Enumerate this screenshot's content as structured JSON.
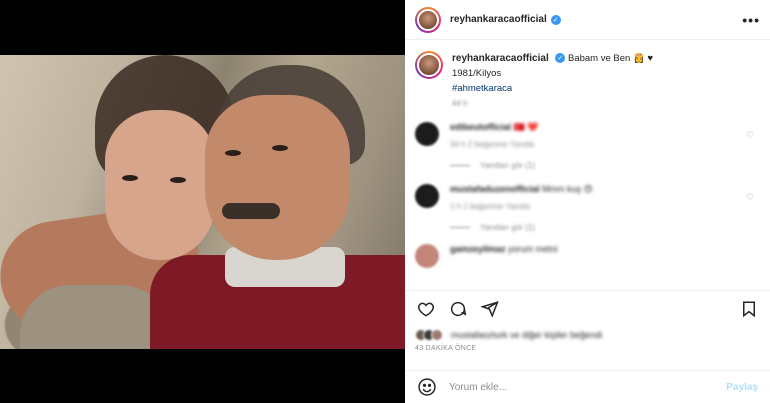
{
  "post": {
    "username": "reyhankaracaofficial",
    "more_icon": "more-horizontal-icon",
    "verified_icon": "verified-badge-icon"
  },
  "caption": {
    "username": "reyhankaracaofficial",
    "text_line1": "Babam ve Ben 👸 ♥",
    "text_line2": "1981/Kilyos",
    "hashtag": "#ahmetkaraca",
    "meta": "44 h"
  },
  "comments": [
    {
      "username": "edibeutofficial",
      "text": "🇹🇷 ❤️",
      "meta": "34 h   2 beğenme   Yanıtla",
      "replies": "Yanıtları gör (1)"
    },
    {
      "username": "mustafaduzenofficial",
      "text": "Mmm kuş 😍",
      "meta": "1 h   1 beğenme   Yanıtla",
      "replies": "Yanıtları gör (1)"
    },
    {
      "username": "gamzeyilmaz",
      "text": "yorum metni",
      "meta": "",
      "replies": ""
    }
  ],
  "actions": {
    "like_icon": "heart-icon",
    "comment_icon": "comment-icon",
    "share_icon": "share-icon",
    "save_icon": "bookmark-icon"
  },
  "likes": {
    "text": "mustafaozturk ve diğer kişiler beğendi"
  },
  "time_ago": "43 DAKİKA ÖNCE",
  "add_comment": {
    "placeholder": "Yorum ekle...",
    "post_label": "Paylaş",
    "emoji_icon": "smile-icon"
  },
  "colors": {
    "link": "#00376b",
    "verified": "#3897f0",
    "post_button_disabled": "#b2dffc",
    "secondary_text": "#8e8e8e"
  }
}
